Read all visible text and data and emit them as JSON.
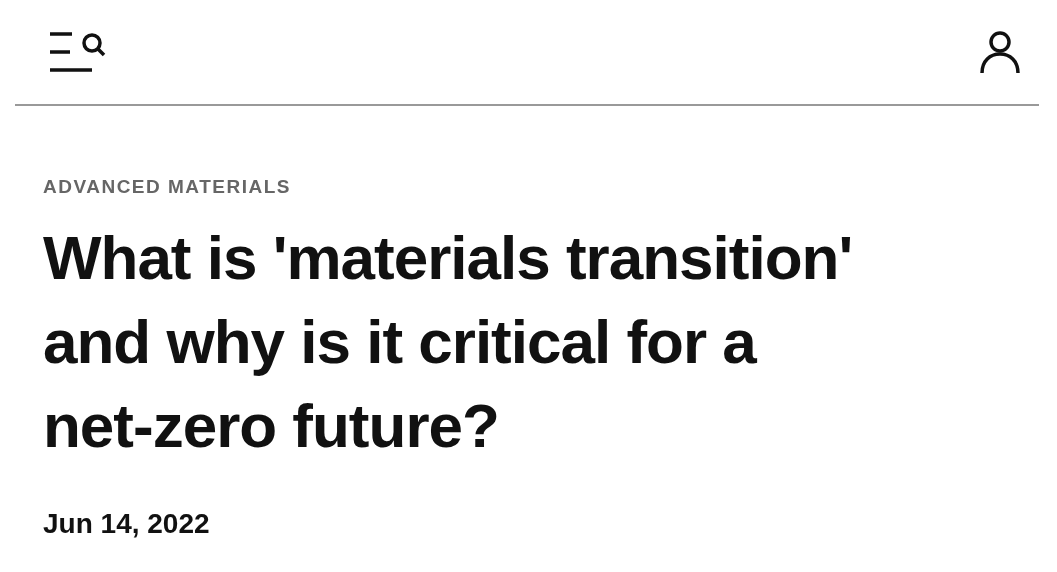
{
  "article": {
    "category": "ADVANCED MATERIALS",
    "title_lines": [
      "What is 'materials transition'",
      "and why is it critical for a",
      "net-zero future?"
    ],
    "date": "Jun 14, 2022"
  }
}
